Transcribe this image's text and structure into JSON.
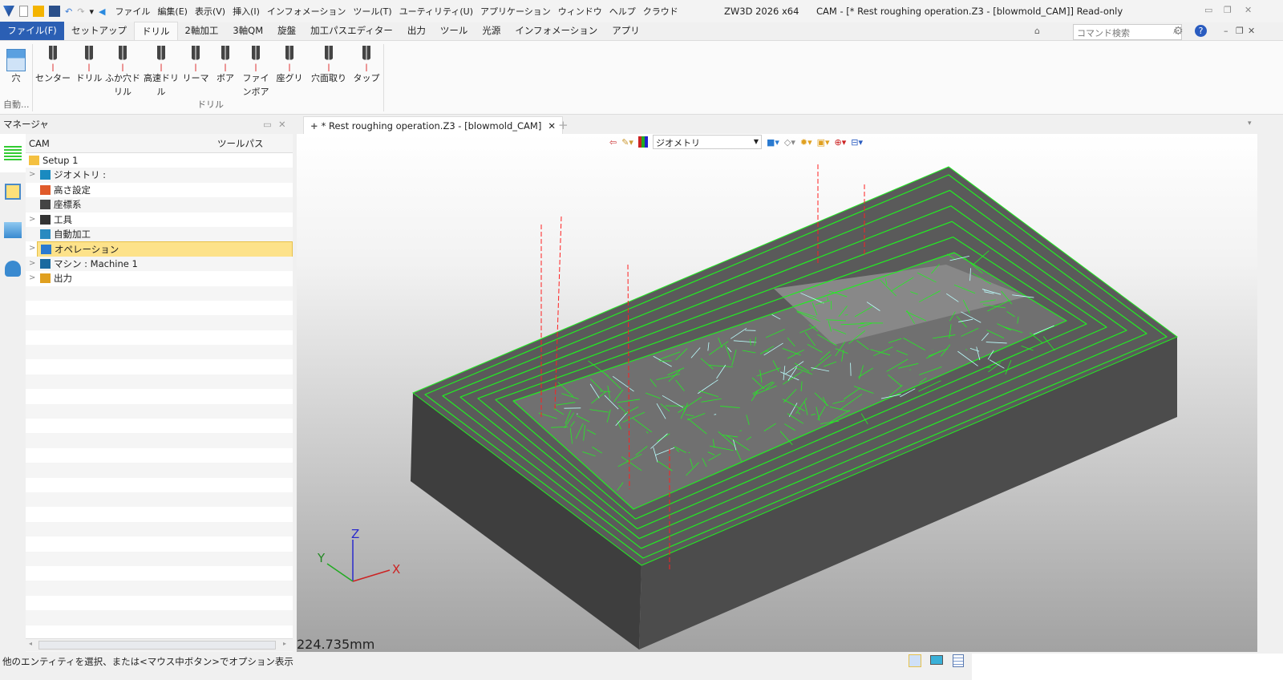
{
  "titlebar": {
    "app": "ZW3D 2026 x64",
    "document": "CAM - [* Rest roughing operation.Z3 - [blowmold_CAM]] Read-only",
    "menu": [
      "ファイル",
      "編集(E)",
      "表示(V)",
      "挿入(I)",
      "インフォメーション",
      "ツール(T)",
      "ユーティリティ(U)",
      "アプリケーション",
      "ウィンドウ",
      "ヘルプ",
      "クラウド"
    ]
  },
  "ribbon": {
    "tabs": [
      "ファイル(F)",
      "セットアップ",
      "ドリル",
      "2軸加工",
      "3軸QM",
      "旋盤",
      "加工パスエディター",
      "出力",
      "ツール",
      "光源",
      "インフォメーション",
      "アプリ"
    ],
    "active_tab": "ドリル",
    "search_placeholder": "コマンド検索",
    "group_auto": {
      "label": "自動...",
      "button": "穴"
    },
    "group_drill": {
      "label": "ドリル",
      "buttons": [
        "センター",
        "ドリル",
        "ふか穴ドリル",
        "高速ドリル",
        "リーマ",
        "ボア",
        "ファインボア",
        "座グリ",
        "穴面取り",
        "タップ"
      ]
    }
  },
  "manager": {
    "title": "マネージャ",
    "col_cam": "CAM",
    "col_toolpath": "ツールパス",
    "tree": [
      {
        "label": "Setup 1",
        "expandable": false,
        "indent": 0
      },
      {
        "label": "ジオメトリ :",
        "expandable": true,
        "indent": 1
      },
      {
        "label": "高さ設定",
        "expandable": false,
        "indent": 1
      },
      {
        "label": "座標系",
        "expandable": false,
        "indent": 1
      },
      {
        "label": "工具",
        "expandable": true,
        "indent": 1
      },
      {
        "label": "自動加工",
        "expandable": false,
        "indent": 1
      },
      {
        "label": "オペレーション",
        "expandable": true,
        "indent": 1,
        "selected": true
      },
      {
        "label": "マシン : Machine 1",
        "expandable": true,
        "indent": 1
      },
      {
        "label": "出力",
        "expandable": true,
        "indent": 1
      }
    ]
  },
  "viewport": {
    "tab": "* Rest roughing operation.Z3 - [blowmold_CAM]",
    "filter": "ジオメトリ",
    "scale": "224.735mm",
    "axes": {
      "x": "X",
      "y": "Y",
      "z": "Z"
    },
    "colors": {
      "toolpath": "#22ee22",
      "rapid": "#ff2020",
      "block": "#4a4a4a"
    }
  },
  "status": {
    "message": "他のエンティティを選択、または<マウス中ボタン>でオプション表示"
  }
}
